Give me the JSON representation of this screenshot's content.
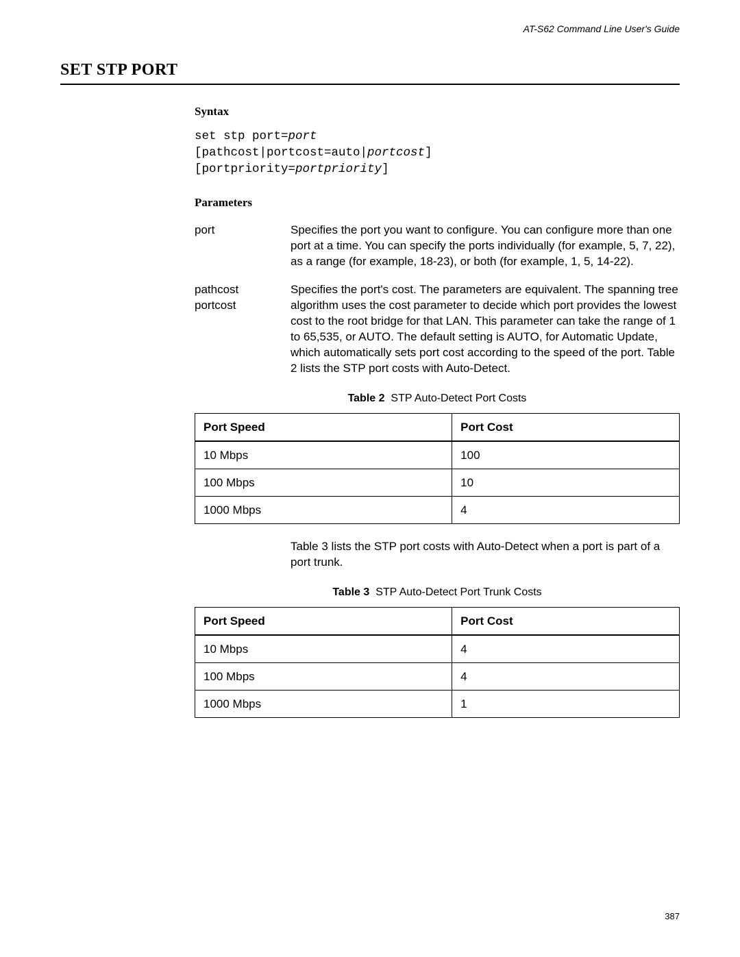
{
  "running_header": "AT-S62 Command Line User's Guide",
  "section_title": "SET STP PORT",
  "syntax": {
    "heading": "Syntax",
    "lines_html": "set stp port=<i>port</i>\n[pathcost|portcost=auto|<i>portcost</i>]\n[portpriority=<i>portpriority</i>]"
  },
  "parameters": {
    "heading": "Parameters",
    "items": [
      {
        "term": "port",
        "desc": "Specifies the port you want to configure. You can configure more than one port at a time. You can specify the ports individually (for example, 5, 7, 22), as a range (for example, 18-23), or both (for example, 1, 5, 14-22)."
      },
      {
        "term": "pathcost\nportcost",
        "desc": "Specifies the port's cost. The parameters are equivalent. The spanning tree algorithm uses the cost parameter to decide which port provides the lowest cost to the root bridge for that LAN. This parameter can take the range of 1 to 65,535, or AUTO. The default setting is AUTO, for Automatic Update, which automatically sets port cost according to the speed of the port. Table 2 lists the STP port costs with Auto-Detect."
      }
    ]
  },
  "table2": {
    "caption_label": "Table 2",
    "caption_text": "STP Auto-Detect Port Costs",
    "columns": [
      "Port Speed",
      "Port Cost"
    ],
    "rows": [
      [
        "10 Mbps",
        "100"
      ],
      [
        "100 Mbps",
        "10"
      ],
      [
        "1000 Mbps",
        "4"
      ]
    ]
  },
  "between_tables_text": "Table 3 lists the STP port costs with Auto-Detect when a port is part of a port trunk.",
  "table3": {
    "caption_label": "Table 3",
    "caption_text": "STP Auto-Detect Port Trunk Costs",
    "columns": [
      "Port Speed",
      "Port Cost"
    ],
    "rows": [
      [
        "10 Mbps",
        "4"
      ],
      [
        "100 Mbps",
        "4"
      ],
      [
        "1000 Mbps",
        "1"
      ]
    ]
  },
  "page_number": "387",
  "chart_data": [
    {
      "type": "table",
      "title": "Table 2 STP Auto-Detect Port Costs",
      "columns": [
        "Port Speed",
        "Port Cost"
      ],
      "rows": [
        [
          "10 Mbps",
          100
        ],
        [
          "100 Mbps",
          10
        ],
        [
          "1000 Mbps",
          4
        ]
      ]
    },
    {
      "type": "table",
      "title": "Table 3 STP Auto-Detect Port Trunk Costs",
      "columns": [
        "Port Speed",
        "Port Cost"
      ],
      "rows": [
        [
          "10 Mbps",
          4
        ],
        [
          "100 Mbps",
          4
        ],
        [
          "1000 Mbps",
          1
        ]
      ]
    }
  ]
}
